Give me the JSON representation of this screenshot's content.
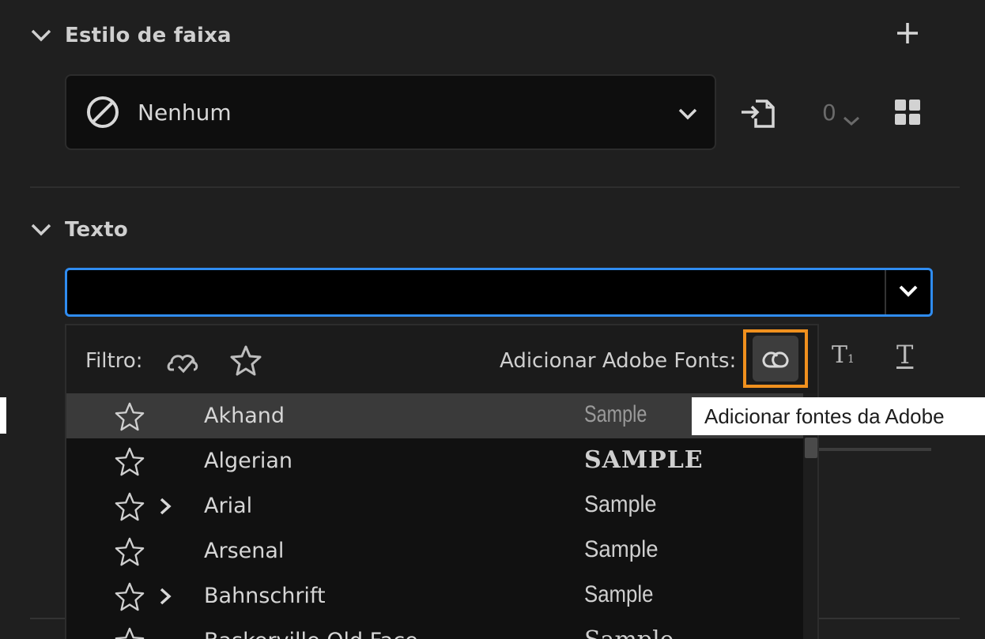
{
  "band_style": {
    "title": "Estilo de faixa",
    "selected": "Nenhum",
    "count": "0"
  },
  "text_section": {
    "title": "Texto",
    "font_input_value": ""
  },
  "font_panel": {
    "filter_label": "Filtro:",
    "add_fonts_label": "Adicionar Adobe Fonts:",
    "tooltip": "Adicionar fontes da Adobe",
    "fonts": [
      {
        "name": "Akhand",
        "sample": "Sample",
        "has_children": false,
        "selected": true
      },
      {
        "name": "Algerian",
        "sample": "SAMPLE",
        "has_children": false,
        "selected": false
      },
      {
        "name": "Arial",
        "sample": "Sample",
        "has_children": true,
        "selected": false
      },
      {
        "name": "Arsenal",
        "sample": "Sample",
        "has_children": false,
        "selected": false
      },
      {
        "name": "Bahnschrift",
        "sample": "Sample",
        "has_children": true,
        "selected": false
      },
      {
        "name": "Baskerville Old Face",
        "sample": "Sample",
        "has_children": false,
        "selected": false
      }
    ]
  },
  "colors": {
    "background": "#1f1f1f",
    "accent_focus": "#2f8cf0",
    "highlight_border": "#f0901e",
    "selected_row": "#3a3a3a"
  },
  "icons": [
    "chevron-down-icon",
    "plus-icon",
    "none-icon",
    "push-to-track-icon",
    "grid-icon",
    "cloud-sync-icon",
    "star-icon",
    "creative-cloud-icon",
    "chevron-right-icon",
    "subscript-icon",
    "underline-icon"
  ]
}
